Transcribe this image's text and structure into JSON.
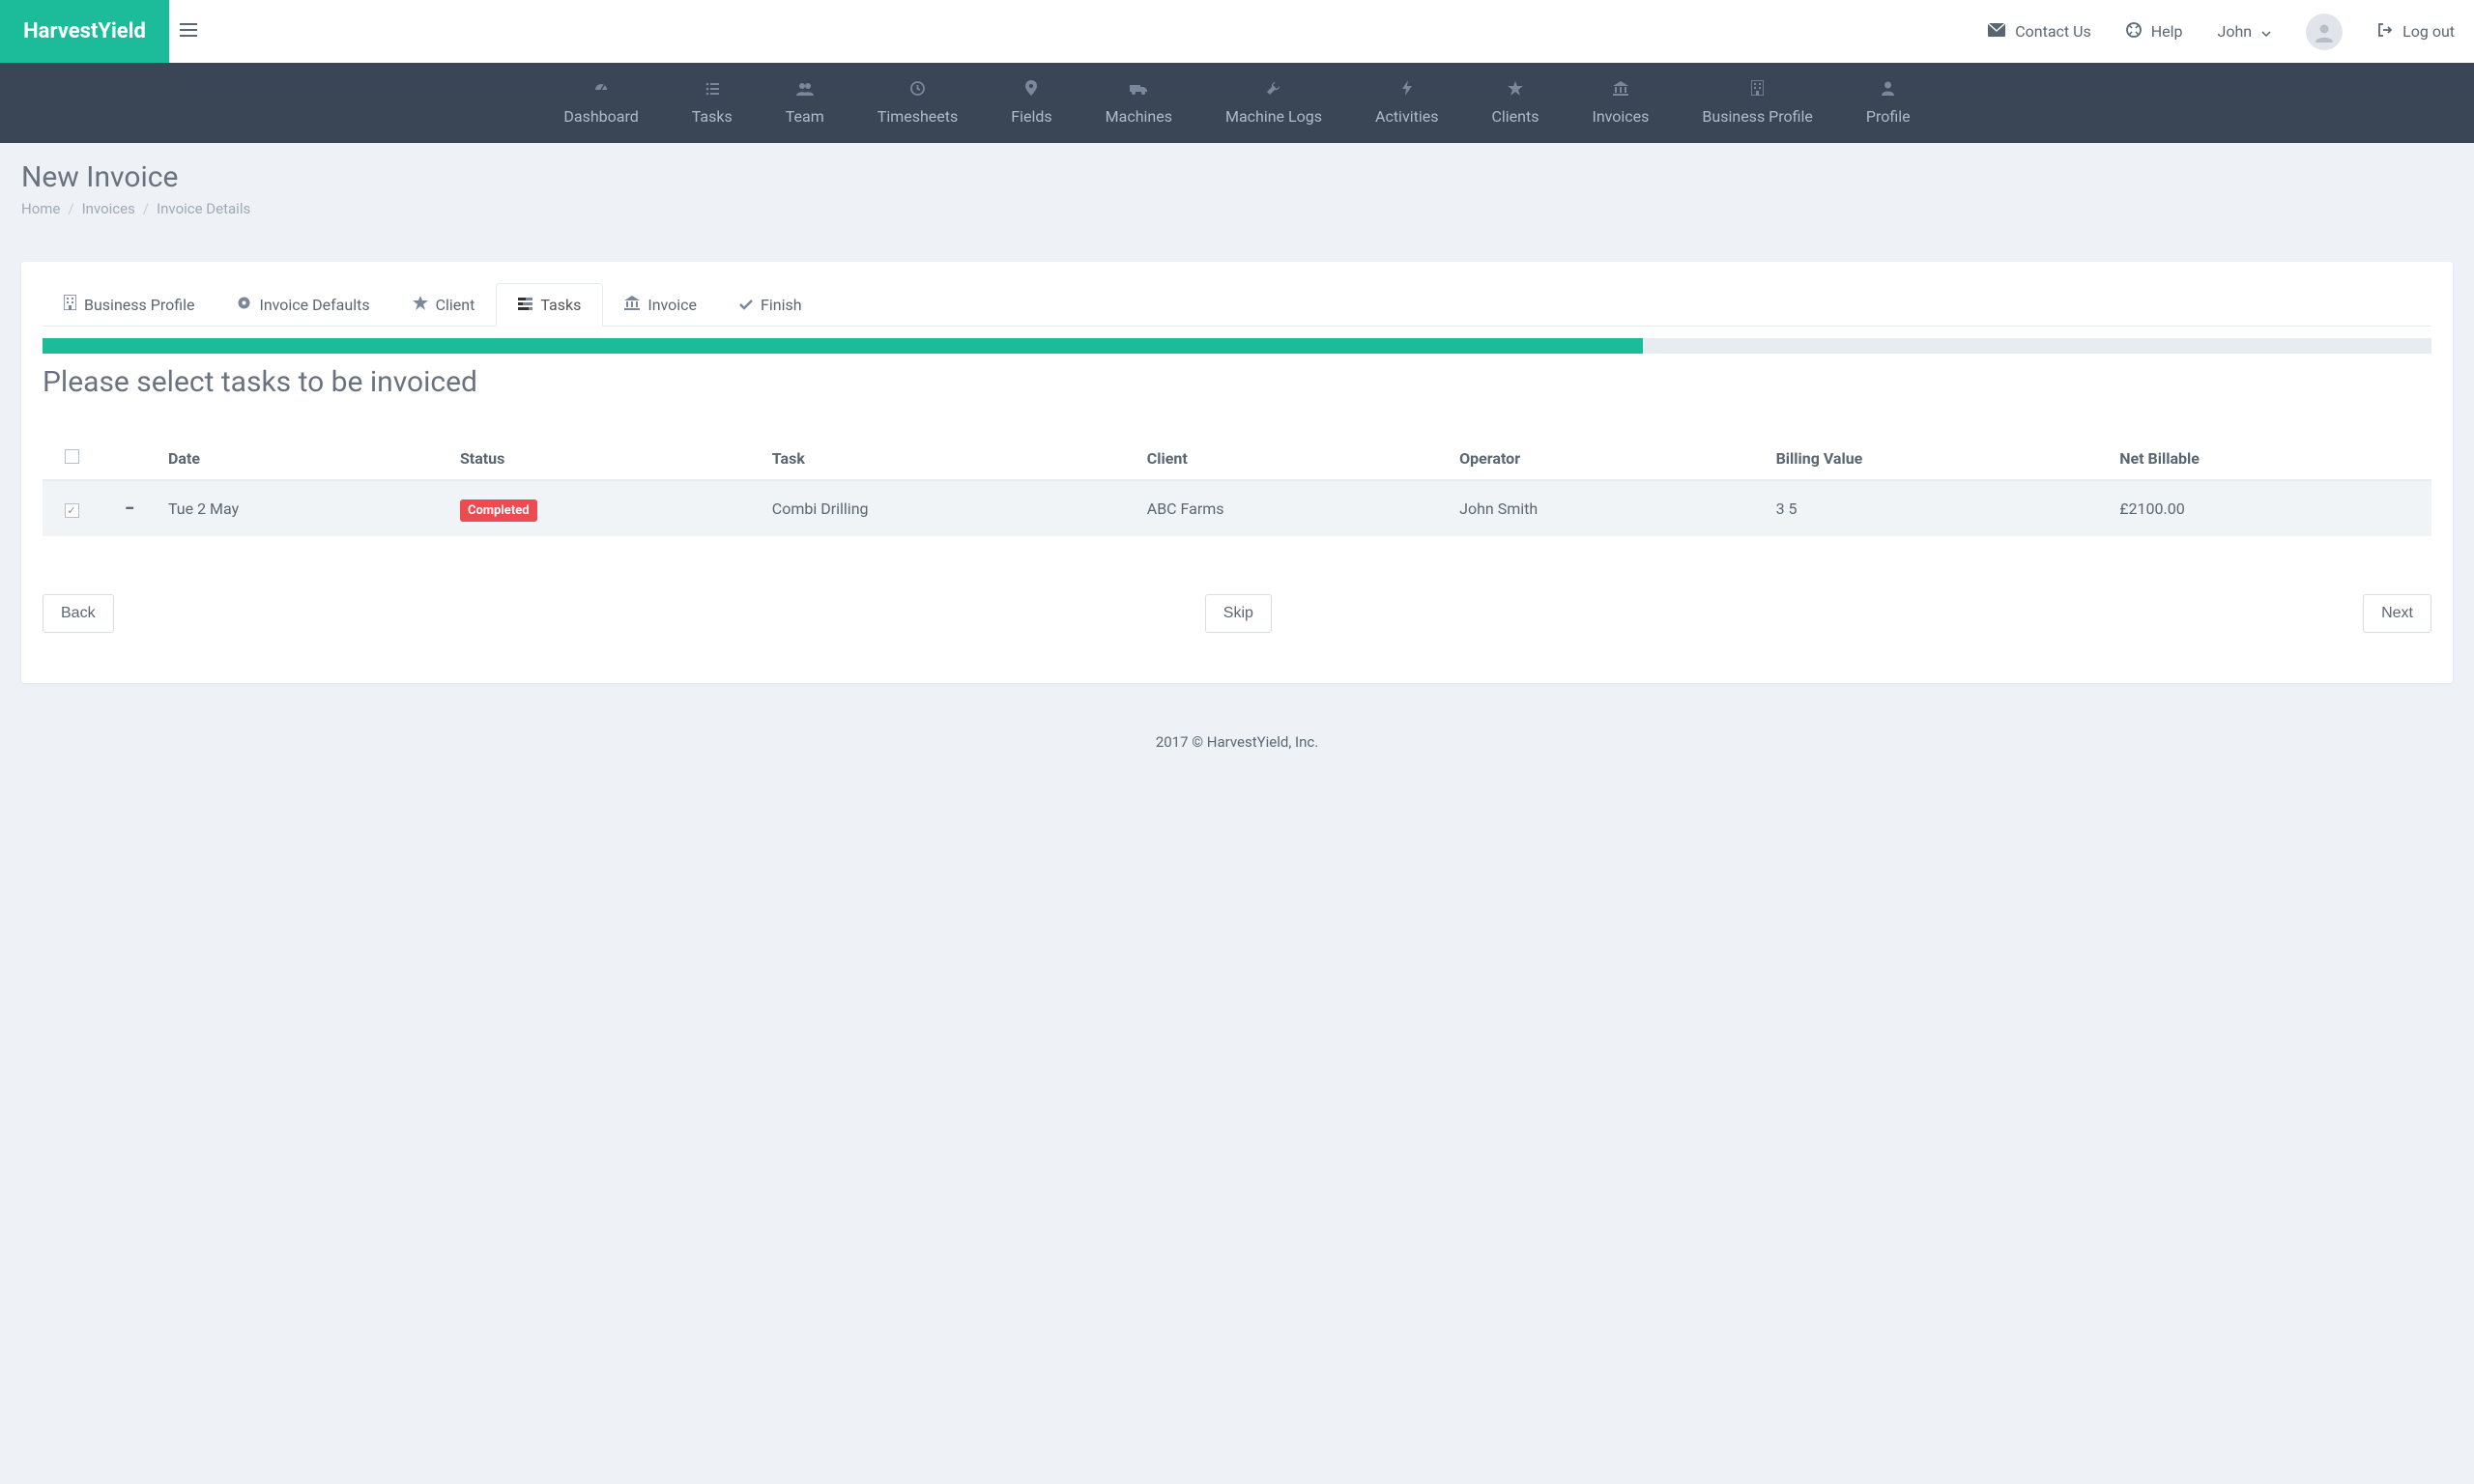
{
  "brand": "HarvestYield",
  "topbar": {
    "contact": "Contact Us",
    "help": "Help",
    "user": "John",
    "logout": "Log out"
  },
  "mainnav": [
    {
      "label": "Dashboard",
      "icon": "dashboard"
    },
    {
      "label": "Tasks",
      "icon": "list"
    },
    {
      "label": "Team",
      "icon": "users"
    },
    {
      "label": "Timesheets",
      "icon": "clock"
    },
    {
      "label": "Fields",
      "icon": "pin"
    },
    {
      "label": "Machines",
      "icon": "truck"
    },
    {
      "label": "Machine Logs",
      "icon": "wrench"
    },
    {
      "label": "Activities",
      "icon": "bolt"
    },
    {
      "label": "Clients",
      "icon": "star"
    },
    {
      "label": "Invoices",
      "icon": "bank"
    },
    {
      "label": "Business Profile",
      "icon": "building"
    },
    {
      "label": "Profile",
      "icon": "user"
    }
  ],
  "page": {
    "title": "New Invoice",
    "breadcrumb": [
      "Home",
      "Invoices",
      "Invoice Details"
    ]
  },
  "wizard": {
    "tabs": [
      {
        "label": "Business Profile",
        "icon": "building"
      },
      {
        "label": "Invoice Defaults",
        "icon": "gear"
      },
      {
        "label": "Client",
        "icon": "star"
      },
      {
        "label": "Tasks",
        "icon": "tasks",
        "active": true
      },
      {
        "label": "Invoice",
        "icon": "bank"
      },
      {
        "label": "Finish",
        "icon": "check"
      }
    ],
    "progress_percent": 67,
    "heading": "Please select tasks to be invoiced"
  },
  "table": {
    "headers": [
      "",
      "",
      "Date",
      "Status",
      "Task",
      "Client",
      "Operator",
      "Billing Value",
      "Net Billable"
    ],
    "rows": [
      {
        "checked": true,
        "expand": "−",
        "date": "Tue 2 May",
        "status": "Completed",
        "task": "Combi Drilling",
        "client": "ABC Farms",
        "operator": "John Smith",
        "billing_value": "3 5",
        "net_billable": "£2100.00"
      }
    ]
  },
  "buttons": {
    "back": "Back",
    "skip": "Skip",
    "next": "Next"
  },
  "footer": "2017 © HarvestYield, Inc."
}
